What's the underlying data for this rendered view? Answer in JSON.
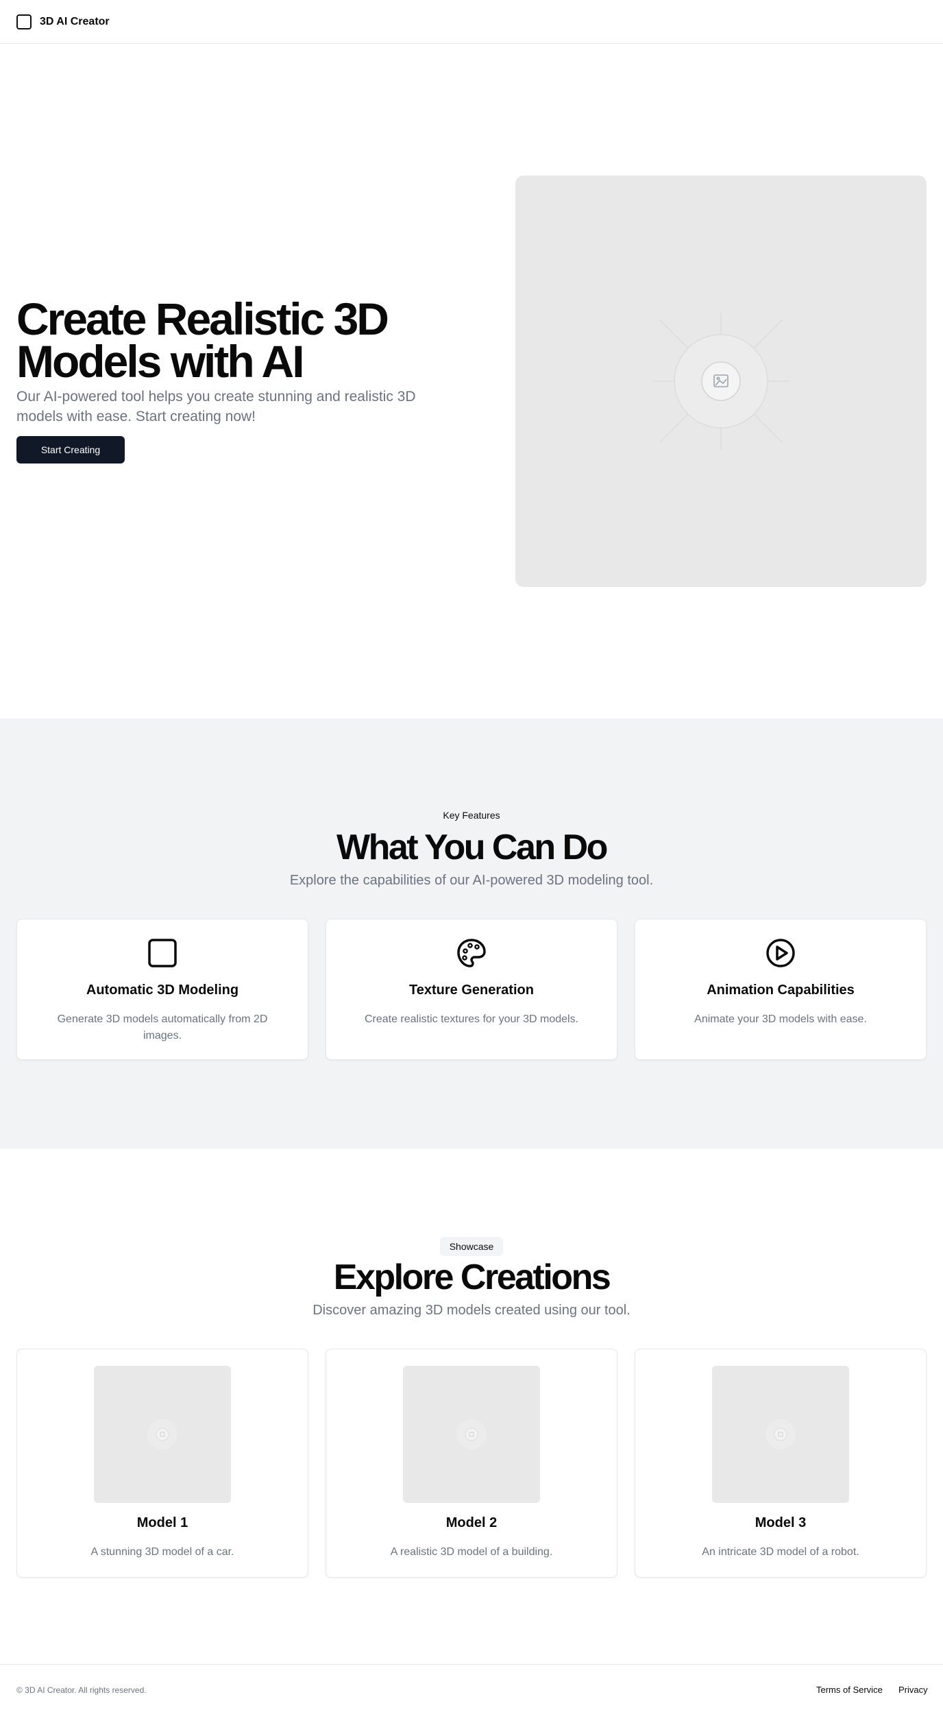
{
  "header": {
    "brand": "3D AI Creator",
    "brand_icon": "square-icon"
  },
  "hero": {
    "title": "Create Realistic 3D Models with AI",
    "subtitle": "Our AI-powered tool helps you create stunning and realistic 3D models with ease. Start creating now!",
    "cta_label": "Start Creating",
    "image_icon": "image-placeholder-icon"
  },
  "features": {
    "eyebrow": "Key Features",
    "title": "What You Can Do",
    "subtitle": "Explore the capabilities of our AI-powered 3D modeling tool.",
    "items": [
      {
        "icon": "square-icon",
        "title": "Automatic 3D Modeling",
        "description": "Generate 3D models automatically from 2D images."
      },
      {
        "icon": "palette-icon",
        "title": "Texture Generation",
        "description": "Create realistic textures for your 3D models."
      },
      {
        "icon": "play-circle-icon",
        "title": "Animation Capabilities",
        "description": "Animate your 3D models with ease."
      }
    ]
  },
  "showcase": {
    "badge": "Showcase",
    "title": "Explore Creations",
    "subtitle": "Discover amazing 3D models created using our tool.",
    "items": [
      {
        "title": "Model 1",
        "description": "A stunning 3D model of a car."
      },
      {
        "title": "Model 2",
        "description": "A realistic 3D model of a building."
      },
      {
        "title": "Model 3",
        "description": "An intricate 3D model of a robot."
      }
    ]
  },
  "footer": {
    "copyright": "© 3D AI Creator. All rights reserved.",
    "links": [
      "Terms of Service",
      "Privacy"
    ]
  },
  "colors": {
    "primary_button": "#111827",
    "muted_text": "#6b7280",
    "section_bg": "#f2f3f5",
    "placeholder_bg": "#e8e8e8"
  }
}
